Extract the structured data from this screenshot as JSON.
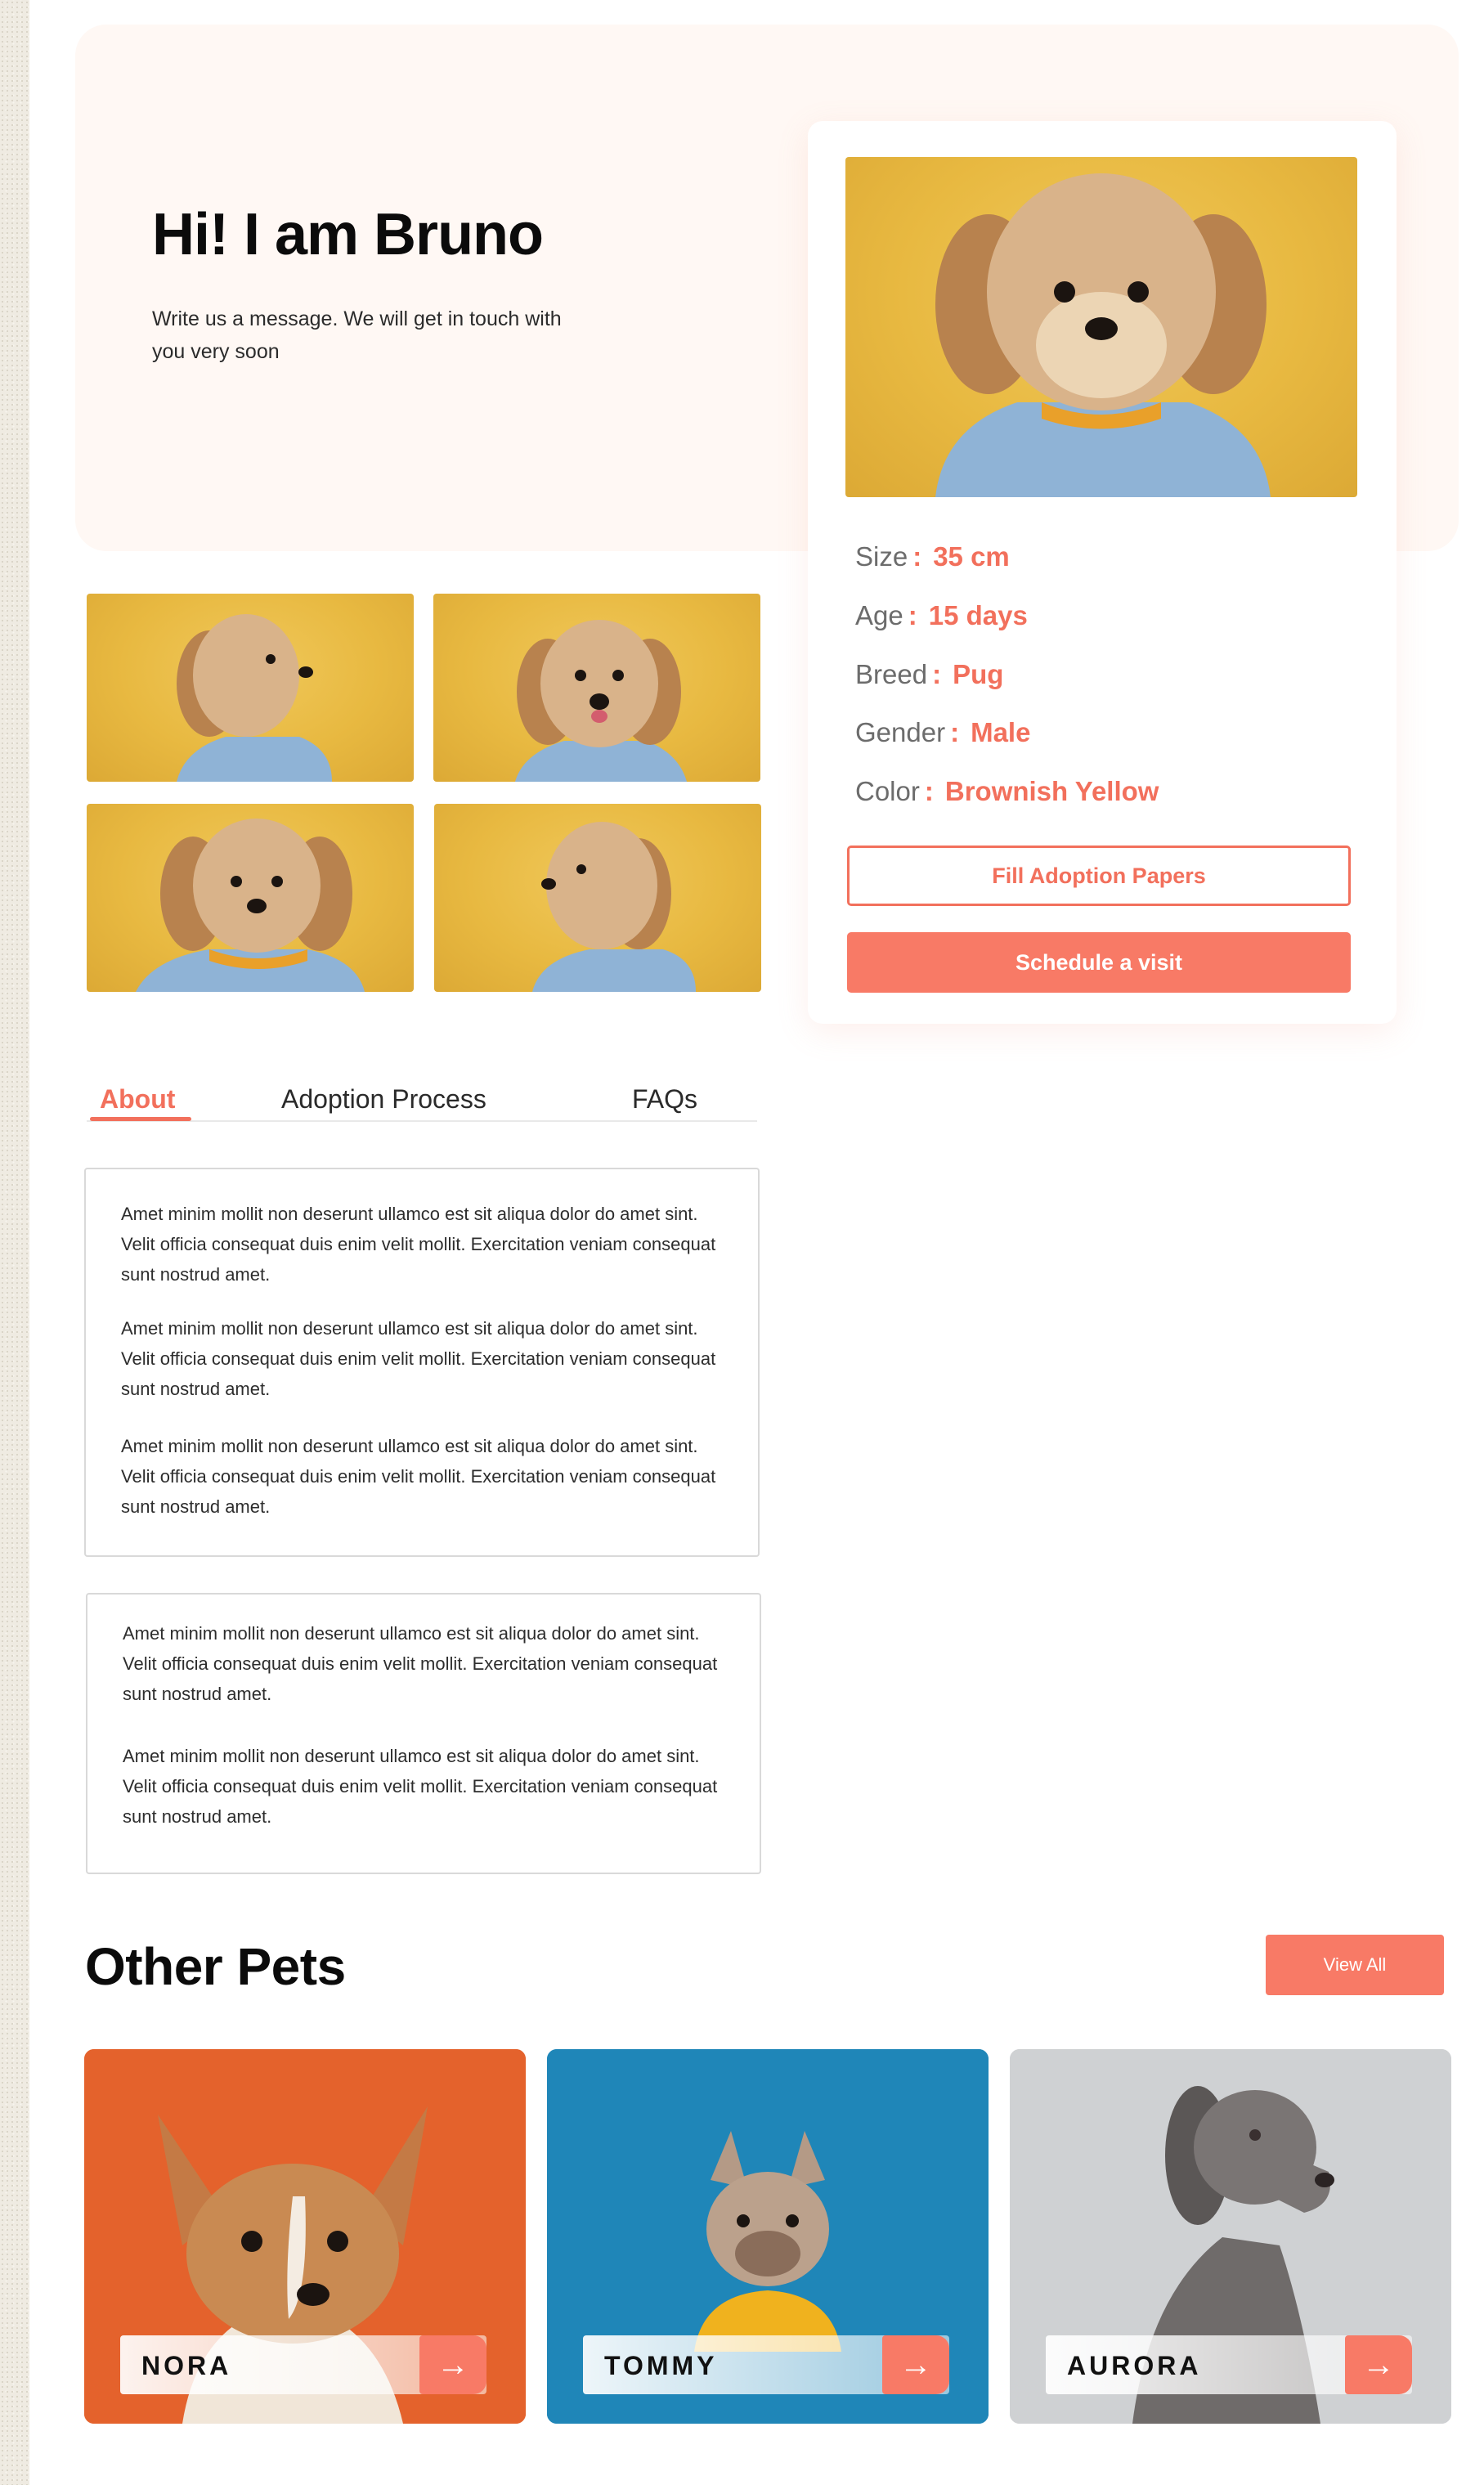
{
  "hero": {
    "title": "Hi! I am Bruno",
    "subtitle": "Write us a message. We will get in touch with you very soon"
  },
  "specs": [
    {
      "label": "Size",
      "value": "35 cm"
    },
    {
      "label": "Age",
      "value": "15 days"
    },
    {
      "label": "Breed",
      "value": "Pug"
    },
    {
      "label": "Gender",
      "value": "Male"
    },
    {
      "label": "Color",
      "value": "Brownish Yellow"
    }
  ],
  "spec_separator": ":",
  "actions": {
    "fill_papers": "Fill Adoption Papers",
    "schedule_visit": "Schedule a visit"
  },
  "tabs": [
    {
      "label": "About",
      "active": true
    },
    {
      "label": "Adoption Process",
      "active": false
    },
    {
      "label": "FAQs",
      "active": false
    }
  ],
  "about_box_1": [
    "Amet minim mollit non deserunt ullamco est sit aliqua dolor do amet sint. Velit officia consequat duis enim velit mollit. Exercitation veniam consequat sunt nostrud amet.",
    "Amet minim mollit non deserunt ullamco est sit aliqua dolor do amet sint. Velit officia consequat duis enim velit mollit. Exercitation veniam consequat sunt nostrud amet.",
    "Amet minim mollit non deserunt ullamco est sit aliqua dolor do amet sint. Velit officia consequat duis enim velit mollit. Exercitation veniam consequat sunt nostrud amet."
  ],
  "about_box_2": [
    "Amet minim mollit non deserunt ullamco est sit aliqua dolor do amet sint. Velit officia consequat duis enim velit mollit. Exercitation veniam consequat sunt nostrud amet.",
    "Amet minim mollit non deserunt ullamco est sit aliqua dolor do amet sint. Velit officia consequat duis enim velit mollit. Exercitation veniam consequat sunt nostrud amet."
  ],
  "other_pets": {
    "title": "Other Pets",
    "view_all": "View All",
    "pets": [
      {
        "name": "NORA",
        "bg": "#e4622c"
      },
      {
        "name": "TOMMY",
        "bg": "#1f86b8"
      },
      {
        "name": "AURORA",
        "bg": "#cfd1d3"
      }
    ]
  },
  "colors": {
    "accent": "#f87a66",
    "accent_text": "#f2705c",
    "hero_bg": "#fff8f4",
    "photo_bg": "#e8b941"
  },
  "icons": {
    "pet_arrow": "arrow-right-icon"
  }
}
